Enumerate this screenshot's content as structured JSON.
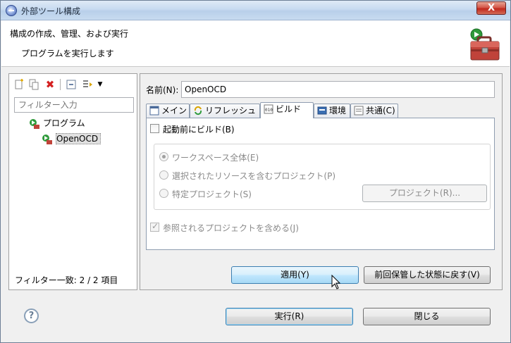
{
  "window": {
    "title": "外部ツール構成",
    "close_glyph": "X"
  },
  "header": {
    "title": "構成の作成、管理、および実行",
    "message": "プログラムを実行します"
  },
  "left": {
    "toolbar_icons": [
      "new-config-icon",
      "duplicate-icon",
      "delete-icon",
      "collapse-all-icon",
      "filter-icon",
      "dropdown-icon"
    ],
    "filter_placeholder": "フィルター入力",
    "tree": [
      {
        "label": "プログラム",
        "icon": "program-type-icon"
      },
      {
        "label": "OpenOCD",
        "icon": "launch-config-icon",
        "selected": true
      }
    ],
    "status": "フィルター一致: 2 / 2 項目"
  },
  "right": {
    "name_label": "名前(N):",
    "name_value": "OpenOCD",
    "tabs": [
      {
        "label": "メイン",
        "icon": "main-tab-icon"
      },
      {
        "label": "リフレッシュ",
        "icon": "refresh-tab-icon"
      },
      {
        "label": "ビルド",
        "icon": "build-tab-icon",
        "active": true
      },
      {
        "label": "環境",
        "icon": "environment-tab-icon"
      },
      {
        "label": "共通(C)",
        "icon": "common-tab-icon"
      }
    ],
    "build_before_launch": "起動前にビルド(B)",
    "radio_workspace": "ワークスペース全体(E)",
    "radio_selected": "選択されたリソースを含むプロジェクト(P)",
    "radio_specific": "特定プロジェクト(S)",
    "project_button": "プロジェクト(R)...",
    "include_referenced": "参照されるプロジェクトを含める(J)",
    "apply_button": "適用(Y)",
    "revert_button": "前回保管した状態に戻す(V)"
  },
  "footer": {
    "help_glyph": "?",
    "run_button": "実行(R)",
    "close_button": "閉じる"
  },
  "colors": {
    "accent": "#3c7fb1",
    "delete_red": "#d42020",
    "run_green": "#2e9a3a"
  }
}
